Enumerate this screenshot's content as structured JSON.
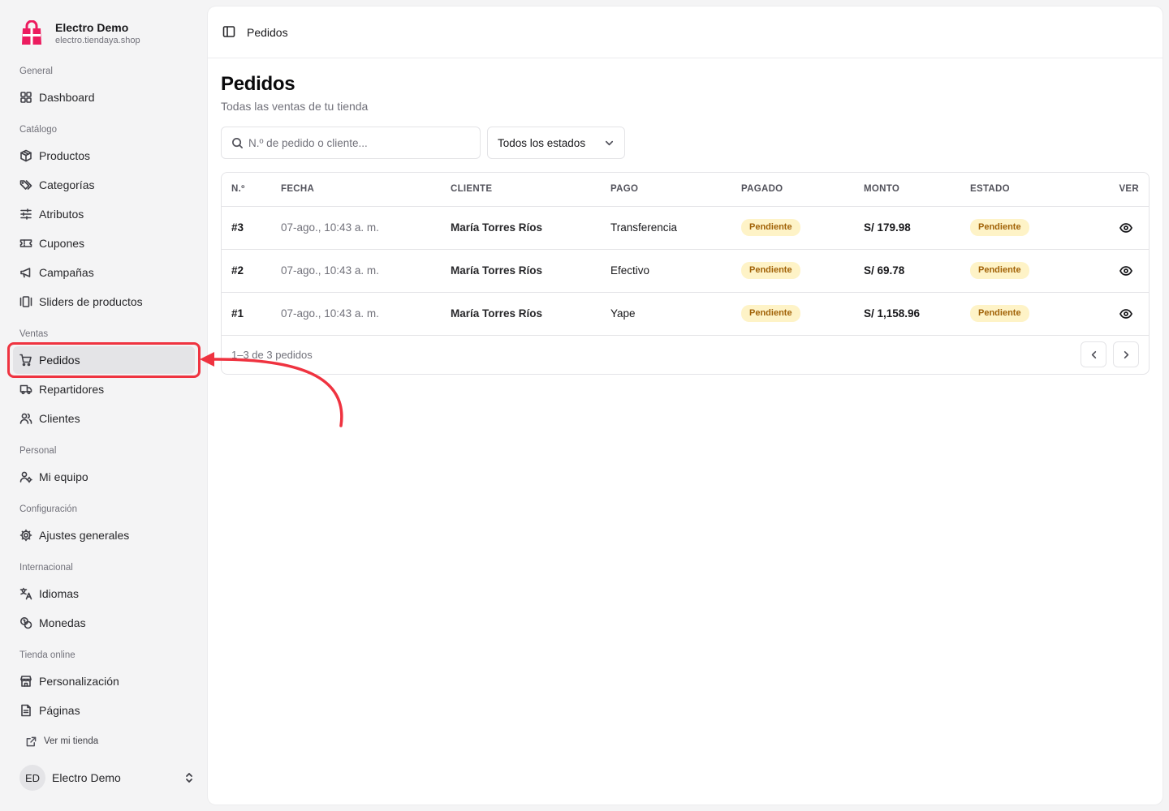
{
  "brand": {
    "name": "Electro Demo",
    "domain": "electro.tiendaya.shop",
    "accent": "#ec1c5f"
  },
  "sidebar": {
    "groups": [
      {
        "label": "General",
        "items": [
          {
            "label": "Dashboard",
            "icon": "dashboard-icon"
          }
        ]
      },
      {
        "label": "Catálogo",
        "items": [
          {
            "label": "Productos",
            "icon": "box-icon"
          },
          {
            "label": "Categorías",
            "icon": "tags-icon"
          },
          {
            "label": "Atributos",
            "icon": "sliders-icon"
          },
          {
            "label": "Cupones",
            "icon": "ticket-icon"
          },
          {
            "label": "Campañas",
            "icon": "megaphone-icon"
          },
          {
            "label": "Sliders de productos",
            "icon": "carousel-icon"
          }
        ]
      },
      {
        "label": "Ventas",
        "items": [
          {
            "label": "Pedidos",
            "icon": "cart-icon",
            "active": true
          },
          {
            "label": "Repartidores",
            "icon": "truck-icon"
          },
          {
            "label": "Clientes",
            "icon": "users-icon"
          }
        ]
      },
      {
        "label": "Personal",
        "items": [
          {
            "label": "Mi equipo",
            "icon": "team-icon"
          }
        ]
      },
      {
        "label": "Configuración",
        "items": [
          {
            "label": "Ajustes generales",
            "icon": "gear-icon"
          }
        ]
      },
      {
        "label": "Internacional",
        "items": [
          {
            "label": "Idiomas",
            "icon": "translate-icon"
          },
          {
            "label": "Monedas",
            "icon": "coins-icon"
          }
        ]
      },
      {
        "label": "Tienda online",
        "items": [
          {
            "label": "Personalización",
            "icon": "store-icon"
          },
          {
            "label": "Páginas",
            "icon": "file-icon"
          }
        ]
      }
    ],
    "view_store": "Ver mi tienda",
    "user": {
      "initials": "ED",
      "name": "Electro Demo"
    }
  },
  "topbar": {
    "title": "Pedidos"
  },
  "page": {
    "title": "Pedidos",
    "subtitle": "Todas las ventas de tu tienda",
    "search_placeholder": "N.º de pedido o cliente...",
    "status_filter": "Todos los estados"
  },
  "table": {
    "columns": [
      "N.º",
      "FECHA",
      "CLIENTE",
      "PAGO",
      "PAGADO",
      "MONTO",
      "ESTADO",
      "VER"
    ],
    "rows": [
      {
        "num": "#3",
        "date": "07-ago., 10:43 a. m.",
        "client": "María Torres Ríos",
        "payment": "Transferencia",
        "paid": "Pendiente",
        "amount": "S/ 179.98",
        "status": "Pendiente"
      },
      {
        "num": "#2",
        "date": "07-ago., 10:43 a. m.",
        "client": "María Torres Ríos",
        "payment": "Efectivo",
        "paid": "Pendiente",
        "amount": "S/ 69.78",
        "status": "Pendiente"
      },
      {
        "num": "#1",
        "date": "07-ago., 10:43 a. m.",
        "client": "María Torres Ríos",
        "payment": "Yape",
        "paid": "Pendiente",
        "amount": "S/ 1,158.96",
        "status": "Pendiente"
      }
    ],
    "footer_count": "1–3 de 3 pedidos"
  },
  "annotation": {
    "color": "#ef3340"
  }
}
